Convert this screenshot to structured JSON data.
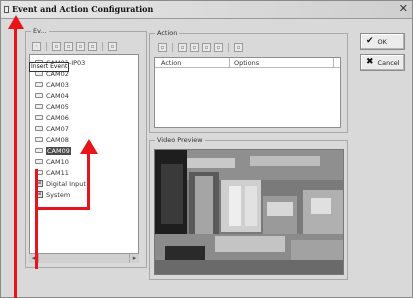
{
  "window": {
    "title": "Event and Action Configuration",
    "close_glyph": "✕"
  },
  "event_group": {
    "label": "Ev..."
  },
  "action_group": {
    "label": "Action"
  },
  "video_group": {
    "label": "Video Preview"
  },
  "event_toolbar_icons": [
    "new-event-icon",
    "copy-event-icon",
    "paste-event-icon",
    "delete-event-icon",
    "properties-event-icon",
    "export-event-icon"
  ],
  "action_toolbar_icons": [
    "new-action-icon",
    "edit-action-icon",
    "copy-action-icon",
    "paste-action-icon",
    "delete-action-icon",
    "test-action-icon"
  ],
  "tree": {
    "items": [
      {
        "label": "CAM01-IP03",
        "icon": "camera-icon"
      },
      {
        "label": "CAM02",
        "icon": "camera-icon"
      },
      {
        "label": "CAM03",
        "icon": "camera-icon"
      },
      {
        "label": "CAM04",
        "icon": "camera-icon"
      },
      {
        "label": "CAM05",
        "icon": "camera-icon"
      },
      {
        "label": "CAM06",
        "icon": "camera-icon"
      },
      {
        "label": "CAM07",
        "icon": "camera-icon"
      },
      {
        "label": "CAM08",
        "icon": "camera-icon"
      },
      {
        "label": "CAM09",
        "icon": "camera-icon",
        "selected": true
      },
      {
        "label": "CAM10",
        "icon": "camera-icon"
      },
      {
        "label": "CAM11",
        "icon": "camera-icon"
      },
      {
        "label": "Digital Input",
        "icon": "folder-icon"
      },
      {
        "label": "System",
        "icon": "folder-icon"
      }
    ],
    "tooltip": "Insert Event"
  },
  "action_table": {
    "columns": [
      "Action",
      "Options"
    ]
  },
  "buttons": {
    "ok": "OK",
    "cancel": "Cancel"
  },
  "colors": {
    "annotation_arrow": "#e8141a",
    "window_bg": "#d9d9d9"
  }
}
